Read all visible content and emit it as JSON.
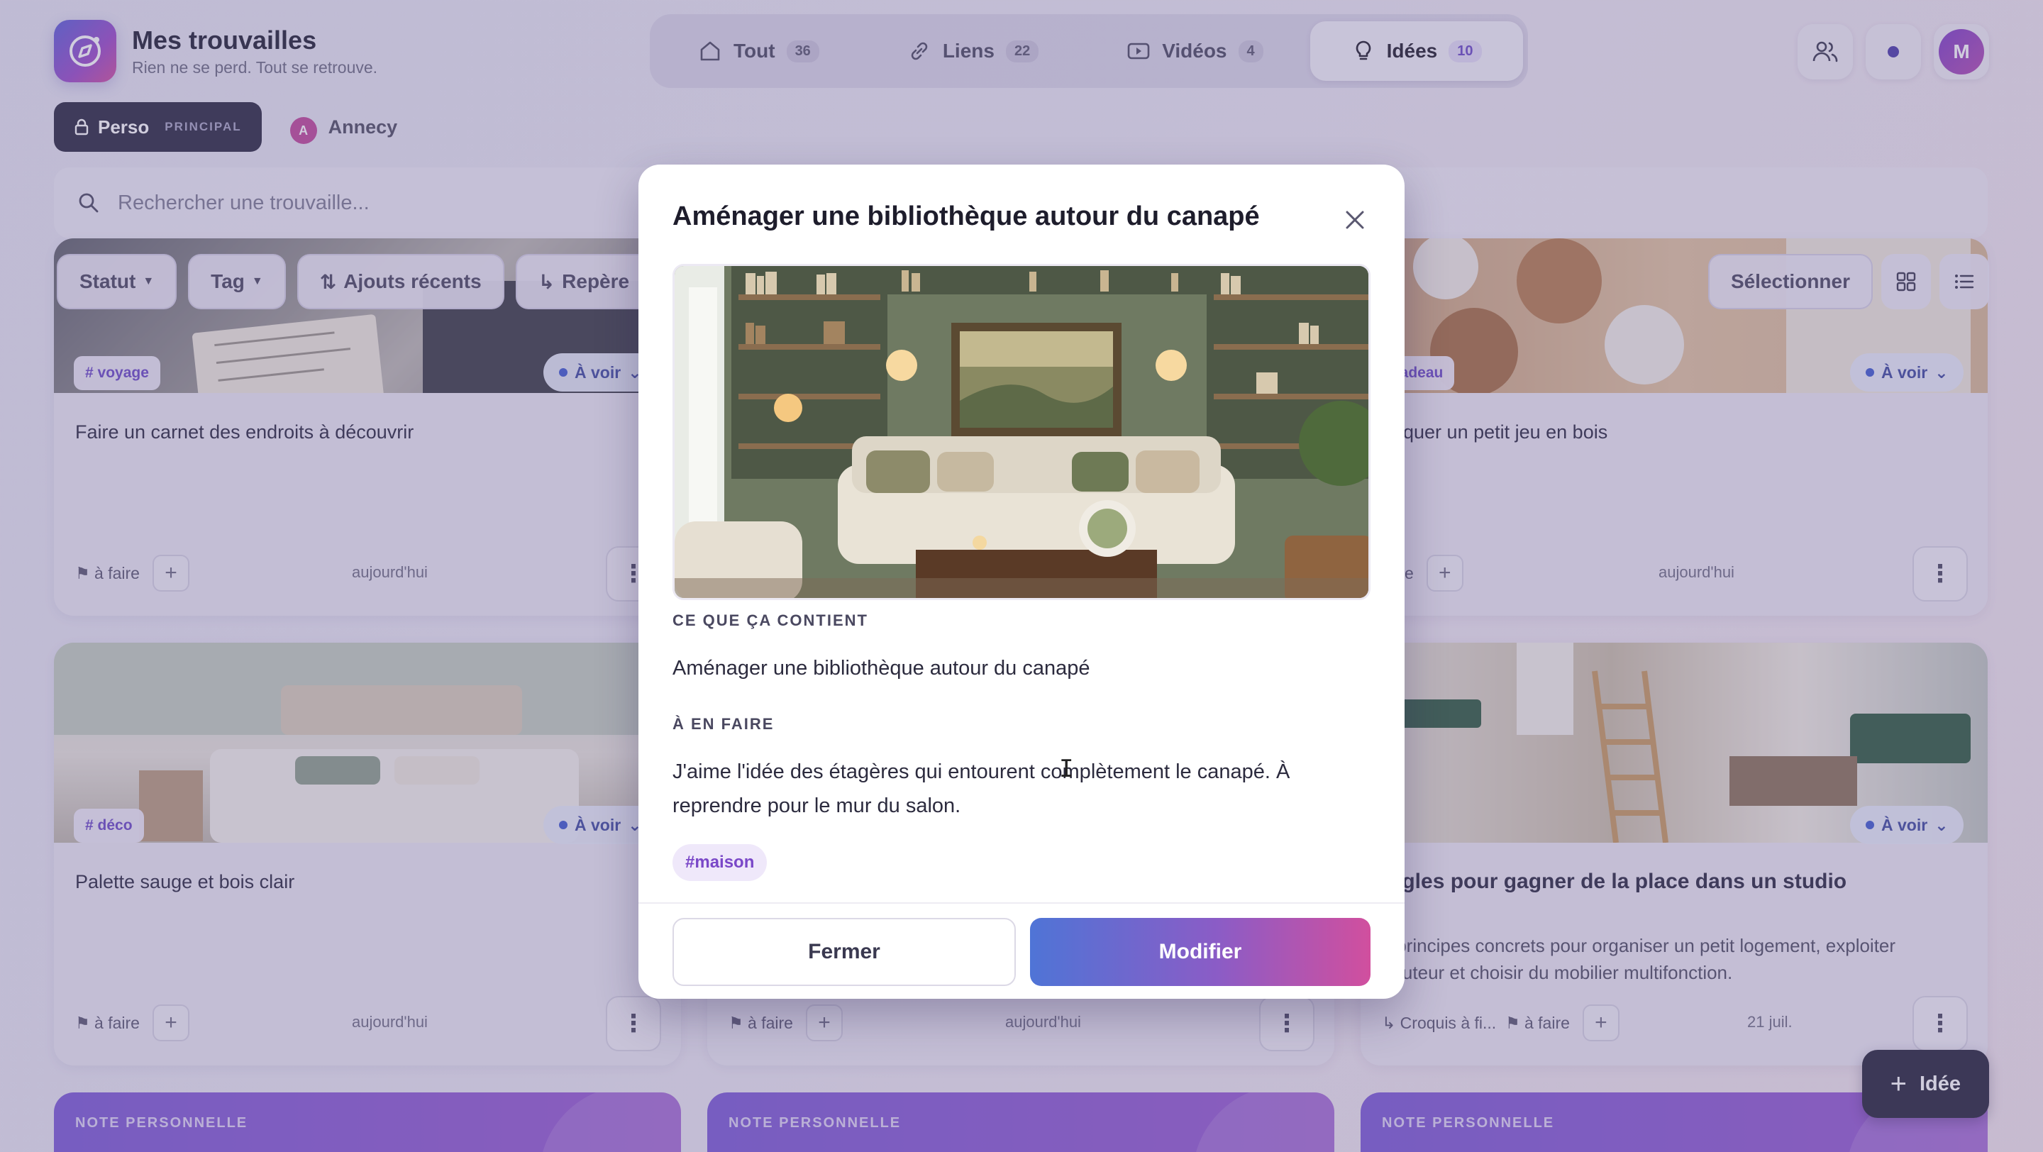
{
  "app": {
    "title": "Mes trouvailles",
    "subtitle": "Rien ne se perd. Tout se retrouve."
  },
  "nav": {
    "tabs": [
      {
        "label": "Tout",
        "count": "36",
        "icon": "home-icon"
      },
      {
        "label": "Liens",
        "count": "22",
        "icon": "link-icon"
      },
      {
        "label": "Vidéos",
        "count": "4",
        "icon": "video-icon"
      },
      {
        "label": "Idées",
        "count": "10",
        "icon": "lightbulb-icon",
        "active": true
      }
    ]
  },
  "header": {
    "avatar_initial": "M"
  },
  "spaces": {
    "perso": {
      "label": "Perso",
      "badge": "PRINCIPAL"
    },
    "annecy": {
      "label": "Annecy",
      "initial": "A"
    }
  },
  "search": {
    "placeholder": "Rechercher une trouvaille..."
  },
  "filters": {
    "statut": "Statut",
    "tag": "Tag",
    "sort": "Ajouts récents",
    "repere": "Repère",
    "select": "Sélectionner"
  },
  "cards": [
    {
      "tag": "# voyage",
      "status": "À voir",
      "title": "Faire un carnet des endroits à découvrir",
      "todo": "à faire",
      "date": "aujourd'hui"
    },
    {
      "tag": "cadeau",
      "status": "À voir",
      "title": "briquer un petit jeu en bois",
      "todo": "faire",
      "date": "aujourd'hui"
    },
    {
      "tag": "# déco",
      "status": "À voir",
      "title": "Palette sauge et bois clair",
      "todo": "à faire",
      "date": "aujourd'hui"
    },
    {
      "todo": "à faire",
      "date": "aujourd'hui"
    },
    {
      "status": "À voir",
      "title": "règles pour gagner de la place dans un studio",
      "desc_1": "s principes concrets pour organiser un petit logement, exploiter",
      "desc_2": "hauteur et choisir du mobilier multifonction.",
      "repere": "Croquis à fi...",
      "todo": "à faire",
      "date": "21 juil."
    }
  ],
  "notes": {
    "label": "NOTE PERSONNELLE"
  },
  "fab": {
    "label": "Idée"
  },
  "modal": {
    "title": "Aménager une bibliothèque autour du canapé",
    "content_label": "CE QUE ÇA CONTIENT",
    "content": "Aménager une bibliothèque autour du canapé",
    "todo_label": "À EN FAIRE",
    "note_line1": "J'aime l'idée des étagères qui entourent complètement le canapé. À",
    "note_line2": "reprendre pour le mur du salon.",
    "hashtag": "#maison",
    "close_label": "Fermer",
    "edit_label": "Modifier"
  },
  "colors": {
    "accent": "#6a49c6",
    "dark": "#26243a",
    "status_blue": "#3e4aa0",
    "gradient_start": "#4f74d6",
    "gradient_end": "#d14f9e"
  }
}
